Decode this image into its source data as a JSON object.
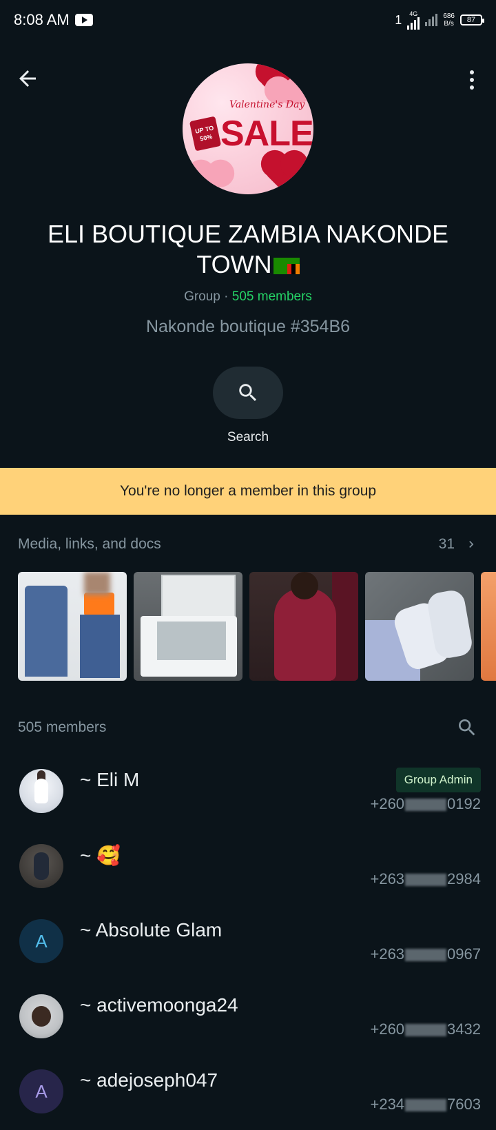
{
  "status_bar": {
    "time": "8:08 AM",
    "sim_indicator": "1",
    "network_type": "4G",
    "speed_value": "686",
    "speed_unit": "B/s",
    "battery": "87"
  },
  "toolbar": {
    "back_icon": "arrow-left-icon",
    "menu_icon": "more-vertical-icon"
  },
  "group": {
    "avatar_text_script": "Valentine's Day",
    "avatar_text_sale": "SALE",
    "avatar_tag": "UP TO 50%",
    "title": "ELI BOUTIQUE  ZAMBIA NAKONDE TOWN",
    "flag": "zambia-flag-icon",
    "type_label": "Group",
    "separator": "·",
    "members_label": "505 members",
    "description": "Nakonde boutique #354B6"
  },
  "actions": {
    "search_label": "Search",
    "search_icon": "search-icon"
  },
  "notice": {
    "text": "You're no longer a member in this group",
    "background": "#ffd279"
  },
  "media": {
    "title": "Media, links, and docs",
    "count": "31"
  },
  "members_section": {
    "title": "505 members",
    "items": [
      {
        "name": "~ Eli M",
        "badge": "Group Admin",
        "phone_prefix": "+260",
        "phone_suffix": "0192"
      },
      {
        "name": "~ 🥰",
        "badge": "",
        "phone_prefix": "+263",
        "phone_suffix": "2984"
      },
      {
        "name": "~ Absolute Glam",
        "badge": "",
        "phone_prefix": "+263",
        "phone_suffix": "0967",
        "initial": "A"
      },
      {
        "name": "~ activemoonga24",
        "badge": "",
        "phone_prefix": "+260",
        "phone_suffix": "3432"
      },
      {
        "name": "~ adejoseph047",
        "badge": "",
        "phone_prefix": "+234",
        "phone_suffix": "7603",
        "initial": "A"
      }
    ]
  },
  "colors": {
    "background": "#0b141a",
    "accent_green": "#25d366",
    "secondary_text": "#8696a0",
    "admin_badge_bg": "#103529"
  }
}
